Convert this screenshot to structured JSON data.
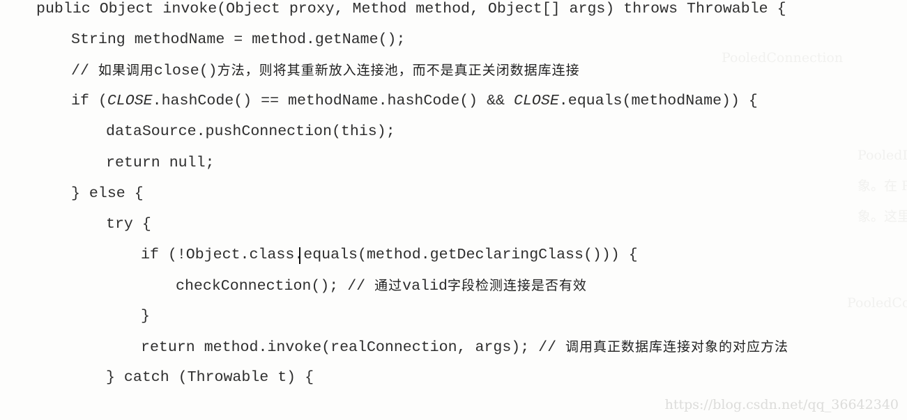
{
  "code_block": {
    "language": "java",
    "lines": [
      {
        "indent": 0,
        "segments": [
          {
            "text": "public Object invoke(Object proxy, Method method, Object[] args) throws Throwable {",
            "style": "code"
          }
        ]
      },
      {
        "indent": 1,
        "segments": [
          {
            "text": "String methodName = method.getName();",
            "style": "code"
          }
        ]
      },
      {
        "indent": 1,
        "segments": [
          {
            "text": "// ",
            "style": "code"
          },
          {
            "text": "如果调用",
            "style": "cjk"
          },
          {
            "text": "close()",
            "style": "code"
          },
          {
            "text": "方法，则将其重新放入连接池，而不是真正关闭数据库连接",
            "style": "cjk"
          }
        ]
      },
      {
        "indent": 1,
        "segments": [
          {
            "text": "if (",
            "style": "code"
          },
          {
            "text": "CLOSE",
            "style": "italic"
          },
          {
            "text": ".hashCode() == methodName.hashCode() && ",
            "style": "code"
          },
          {
            "text": "CLOSE",
            "style": "italic"
          },
          {
            "text": ".equals(methodName)) {",
            "style": "code"
          }
        ]
      },
      {
        "indent": 2,
        "segments": [
          {
            "text": "dataSource.pushConnection(this);",
            "style": "code"
          }
        ]
      },
      {
        "indent": 2,
        "segments": [
          {
            "text": "return null;",
            "style": "code"
          }
        ]
      },
      {
        "indent": 1,
        "segments": [
          {
            "text": "} else {",
            "style": "code"
          }
        ]
      },
      {
        "indent": 2,
        "segments": [
          {
            "text": "try {",
            "style": "code"
          }
        ]
      },
      {
        "indent": 3,
        "segments": [
          {
            "text": "if (!Object.class.equals(method.getDeclaringClass())) {",
            "style": "code"
          }
        ]
      },
      {
        "indent": 4,
        "segments": [
          {
            "text": "checkConnection(); // ",
            "style": "code"
          },
          {
            "text": "通过",
            "style": "cjk"
          },
          {
            "text": "valid",
            "style": "code"
          },
          {
            "text": "字段检测连接是否有效",
            "style": "cjk"
          }
        ]
      },
      {
        "indent": 3,
        "segments": [
          {
            "text": "}",
            "style": "code"
          }
        ]
      },
      {
        "indent": 3,
        "segments": [
          {
            "text": "return method.invoke(realConnection, args); // ",
            "style": "code"
          },
          {
            "text": "调用真正数据库连接对象的对应方法",
            "style": "cjk"
          }
        ]
      },
      {
        "indent": 2,
        "segments": [
          {
            "text": "} catch (Throwable t) {",
            "style": "code"
          }
        ]
      }
    ]
  },
  "watermark": "https://blog.csdn.net/qq_36642340",
  "bleed_through": [
    "PooledConnection",
    "PooledDataSource 中管理的真正的 java.sql.Connection 对象，PooledConnection",
    "象。在 PooledConnection 中封装了真正的数据库连接对象（java.sql.Connection）",
    "象。这里代理对象是通过 JDK 动态代理产生的，PooledConnection 继承了 InvocationHandler",
    "PooledConnection 中的核心字段如下："
  ]
}
